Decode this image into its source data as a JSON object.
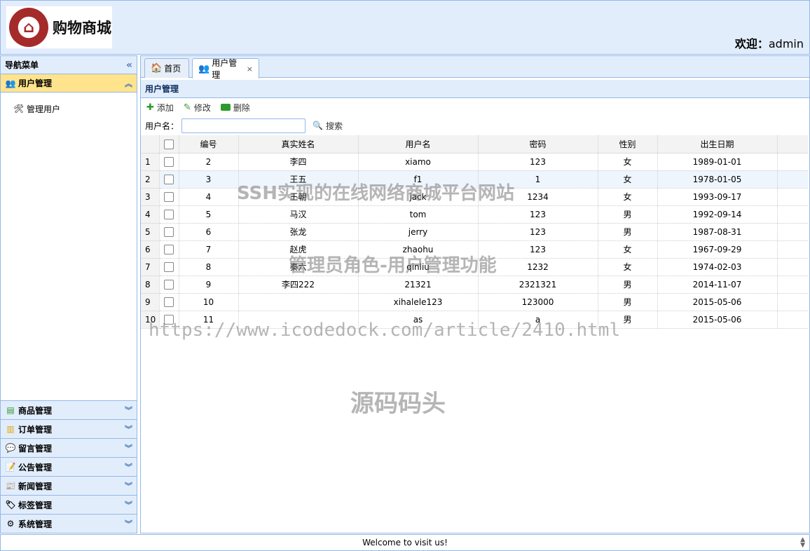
{
  "header": {
    "logo_text": "购物商城",
    "welcome_prefix": "欢迎：",
    "welcome_user": "admin"
  },
  "sidebar": {
    "title": "导航菜单",
    "active_section": {
      "label": "用户管理",
      "items": [
        {
          "label": "管理用户"
        }
      ]
    },
    "sections": [
      {
        "label": "商品管理"
      },
      {
        "label": "订单管理"
      },
      {
        "label": "留言管理"
      },
      {
        "label": "公告管理"
      },
      {
        "label": "新闻管理"
      },
      {
        "label": "标签管理"
      },
      {
        "label": "系统管理"
      }
    ]
  },
  "tabs": [
    {
      "label": "首页"
    },
    {
      "label": "用户管理"
    }
  ],
  "panel": {
    "title": "用户管理"
  },
  "toolbar": {
    "add": "添加",
    "edit": "修改",
    "delete": "删除"
  },
  "search": {
    "label": "用户名：",
    "button": "搜索",
    "value": ""
  },
  "grid": {
    "columns": [
      "编号",
      "真实姓名",
      "用户名",
      "密码",
      "性别",
      "出生日期"
    ],
    "rows": [
      {
        "n": "1",
        "id": "2",
        "name": "李四",
        "user": "xiamo",
        "pwd": "123",
        "sex": "女",
        "dob": "1989-01-01"
      },
      {
        "n": "2",
        "id": "3",
        "name": "王五",
        "user": "f1",
        "pwd": "1",
        "sex": "女",
        "dob": "1978-01-05"
      },
      {
        "n": "3",
        "id": "4",
        "name": "王朝",
        "user": "jack",
        "pwd": "1234",
        "sex": "女",
        "dob": "1993-09-17"
      },
      {
        "n": "4",
        "id": "5",
        "name": "马汉",
        "user": "tom",
        "pwd": "123",
        "sex": "男",
        "dob": "1992-09-14"
      },
      {
        "n": "5",
        "id": "6",
        "name": "张龙",
        "user": "jerry",
        "pwd": "123",
        "sex": "男",
        "dob": "1987-08-31"
      },
      {
        "n": "6",
        "id": "7",
        "name": "赵虎",
        "user": "zhaohu",
        "pwd": "123",
        "sex": "女",
        "dob": "1967-09-29"
      },
      {
        "n": "7",
        "id": "8",
        "name": "秦六",
        "user": "qinliu",
        "pwd": "1232",
        "sex": "女",
        "dob": "1974-02-03"
      },
      {
        "n": "8",
        "id": "9",
        "name": "李四222",
        "user": "21321",
        "pwd": "2321321",
        "sex": "男",
        "dob": "2014-11-07"
      },
      {
        "n": "9",
        "id": "10",
        "name": "",
        "user": "xihalele123",
        "pwd": "123000",
        "sex": "男",
        "dob": "2015-05-06"
      },
      {
        "n": "10",
        "id": "11",
        "name": "",
        "user": "as",
        "pwd": "a",
        "sex": "男",
        "dob": "2015-05-06"
      }
    ]
  },
  "watermarks": {
    "title": "SSH实现的在线网络商城平台网站",
    "subtitle": "管理员角色-用户管理功能",
    "url": "https://www.icodedock.com/article/2410.html",
    "brand": "源码码头"
  },
  "footer": {
    "text": "Welcome to visit us!"
  }
}
